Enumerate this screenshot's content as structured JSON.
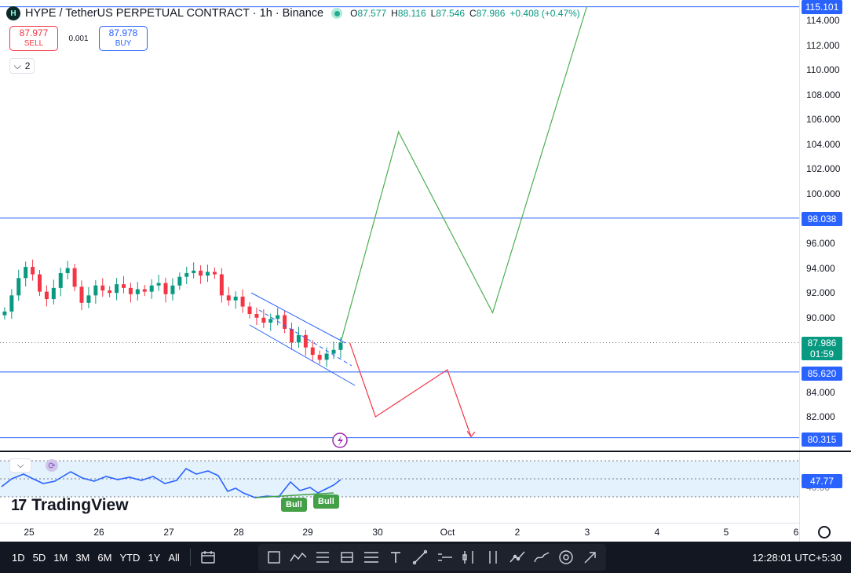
{
  "header": {
    "logo_text": "H",
    "title": "HYPE / TetherUS PERPETUAL CONTRACT · 1h · Binance",
    "ohlc": [
      {
        "k": "O",
        "v": "87.577"
      },
      {
        "k": "H",
        "v": "88.116"
      },
      {
        "k": "L",
        "v": "87.546"
      },
      {
        "k": "C",
        "v": "87.986"
      },
      {
        "k": "",
        "v": "+0.408 (+0.47%)"
      }
    ]
  },
  "trade": {
    "sell_price": "87.977",
    "sell_label": "SELL",
    "spread": "0.001",
    "buy_price": "87.978",
    "buy_label": "BUY"
  },
  "indicators_toggle": {
    "chevron": "⌵",
    "count": "2"
  },
  "price_axis": {
    "ticks": [
      "114.000",
      "112.000",
      "110.000",
      "108.000",
      "106.000",
      "104.000",
      "102.000",
      "100.000",
      "96.000",
      "94.000",
      "92.000",
      "90.000",
      "84.000",
      "82.000"
    ],
    "labels": {
      "level_top": "115.101",
      "level_98": "98.038",
      "current_price": "87.986",
      "countdown": "01:59",
      "level_85": "85.620",
      "level_80": "80.315",
      "rsi_value": "47.77",
      "rsi_tick": "40.00"
    }
  },
  "rsi": {
    "bull_labels": [
      "Bull",
      "Bull"
    ],
    "sync_icon": "⟳"
  },
  "branding": {
    "mark": "17",
    "name": "TradingView"
  },
  "time_axis": {
    "labels": [
      "25",
      "26",
      "27",
      "28",
      "29",
      "30",
      "Oct",
      "2",
      "3",
      "4",
      "5",
      "6"
    ]
  },
  "toolbar": {
    "timeframes": [
      "1D",
      "5D",
      "1M",
      "3M",
      "6M",
      "YTD",
      "1Y",
      "All"
    ],
    "tools": [
      "calendar-range-icon",
      "rectangle-icon",
      "path-icon",
      "long-position-icon",
      "short-position-icon",
      "parallel-channel-icon",
      "text-icon",
      "trend-line-icon",
      "horizontal-ray-icon",
      "date-range-icon",
      "price-range-icon",
      "xabcd-pattern-icon",
      "brush-icon",
      "eye-icon",
      "arrow-icon"
    ],
    "clock": "12:28:01 UTC+5:30"
  },
  "colors": {
    "up": "#089981",
    "down": "#f23645",
    "level": "#2962ff",
    "projection_up": "#4caf50",
    "projection_down": "#f23645",
    "rsi": "#2962ff"
  },
  "chart_data": {
    "type": "candlestick",
    "symbol": "HYPE / TetherUS PERPETUAL CONTRACT",
    "interval": "1h",
    "exchange": "Binance",
    "y_range": [
      79,
      115.8
    ],
    "last_price": 87.986,
    "horizontal_levels": [
      115.101,
      98.038,
      85.62,
      80.315
    ],
    "close_series_approx": [
      90.5,
      91.8,
      93.2,
      94.1,
      93.5,
      92.1,
      91.5,
      92.4,
      93.6,
      94.0,
      92.5,
      91.2,
      91.8,
      92.6,
      92.2,
      92.0,
      92.7,
      92.4,
      91.9,
      92.3,
      92.1,
      92.6,
      92.8,
      91.9,
      92.6,
      93.3,
      93.6,
      93.8,
      93.4,
      93.7,
      93.5,
      91.8,
      91.4,
      91.7,
      90.9,
      90.3,
      90.0,
      89.6,
      89.9,
      90.2,
      89.1,
      88.0,
      88.6,
      87.6,
      87.0,
      86.6,
      87.1,
      87.4,
      87.986
    ],
    "channel": {
      "upper": [
        [
          92.0,
          28.2
        ],
        [
          88.0,
          29.55
        ]
      ],
      "lower": [
        [
          89.0,
          28.2
        ],
        [
          84.4,
          29.65
        ]
      ]
    },
    "projection_bullish": [
      87.986,
      105.0,
      90.4,
      115.101
    ],
    "projection_bearish": [
      87.986,
      82.0,
      85.8,
      80.4
    ],
    "rsi": {
      "last": 47.77,
      "band": [
        30,
        70
      ]
    }
  }
}
